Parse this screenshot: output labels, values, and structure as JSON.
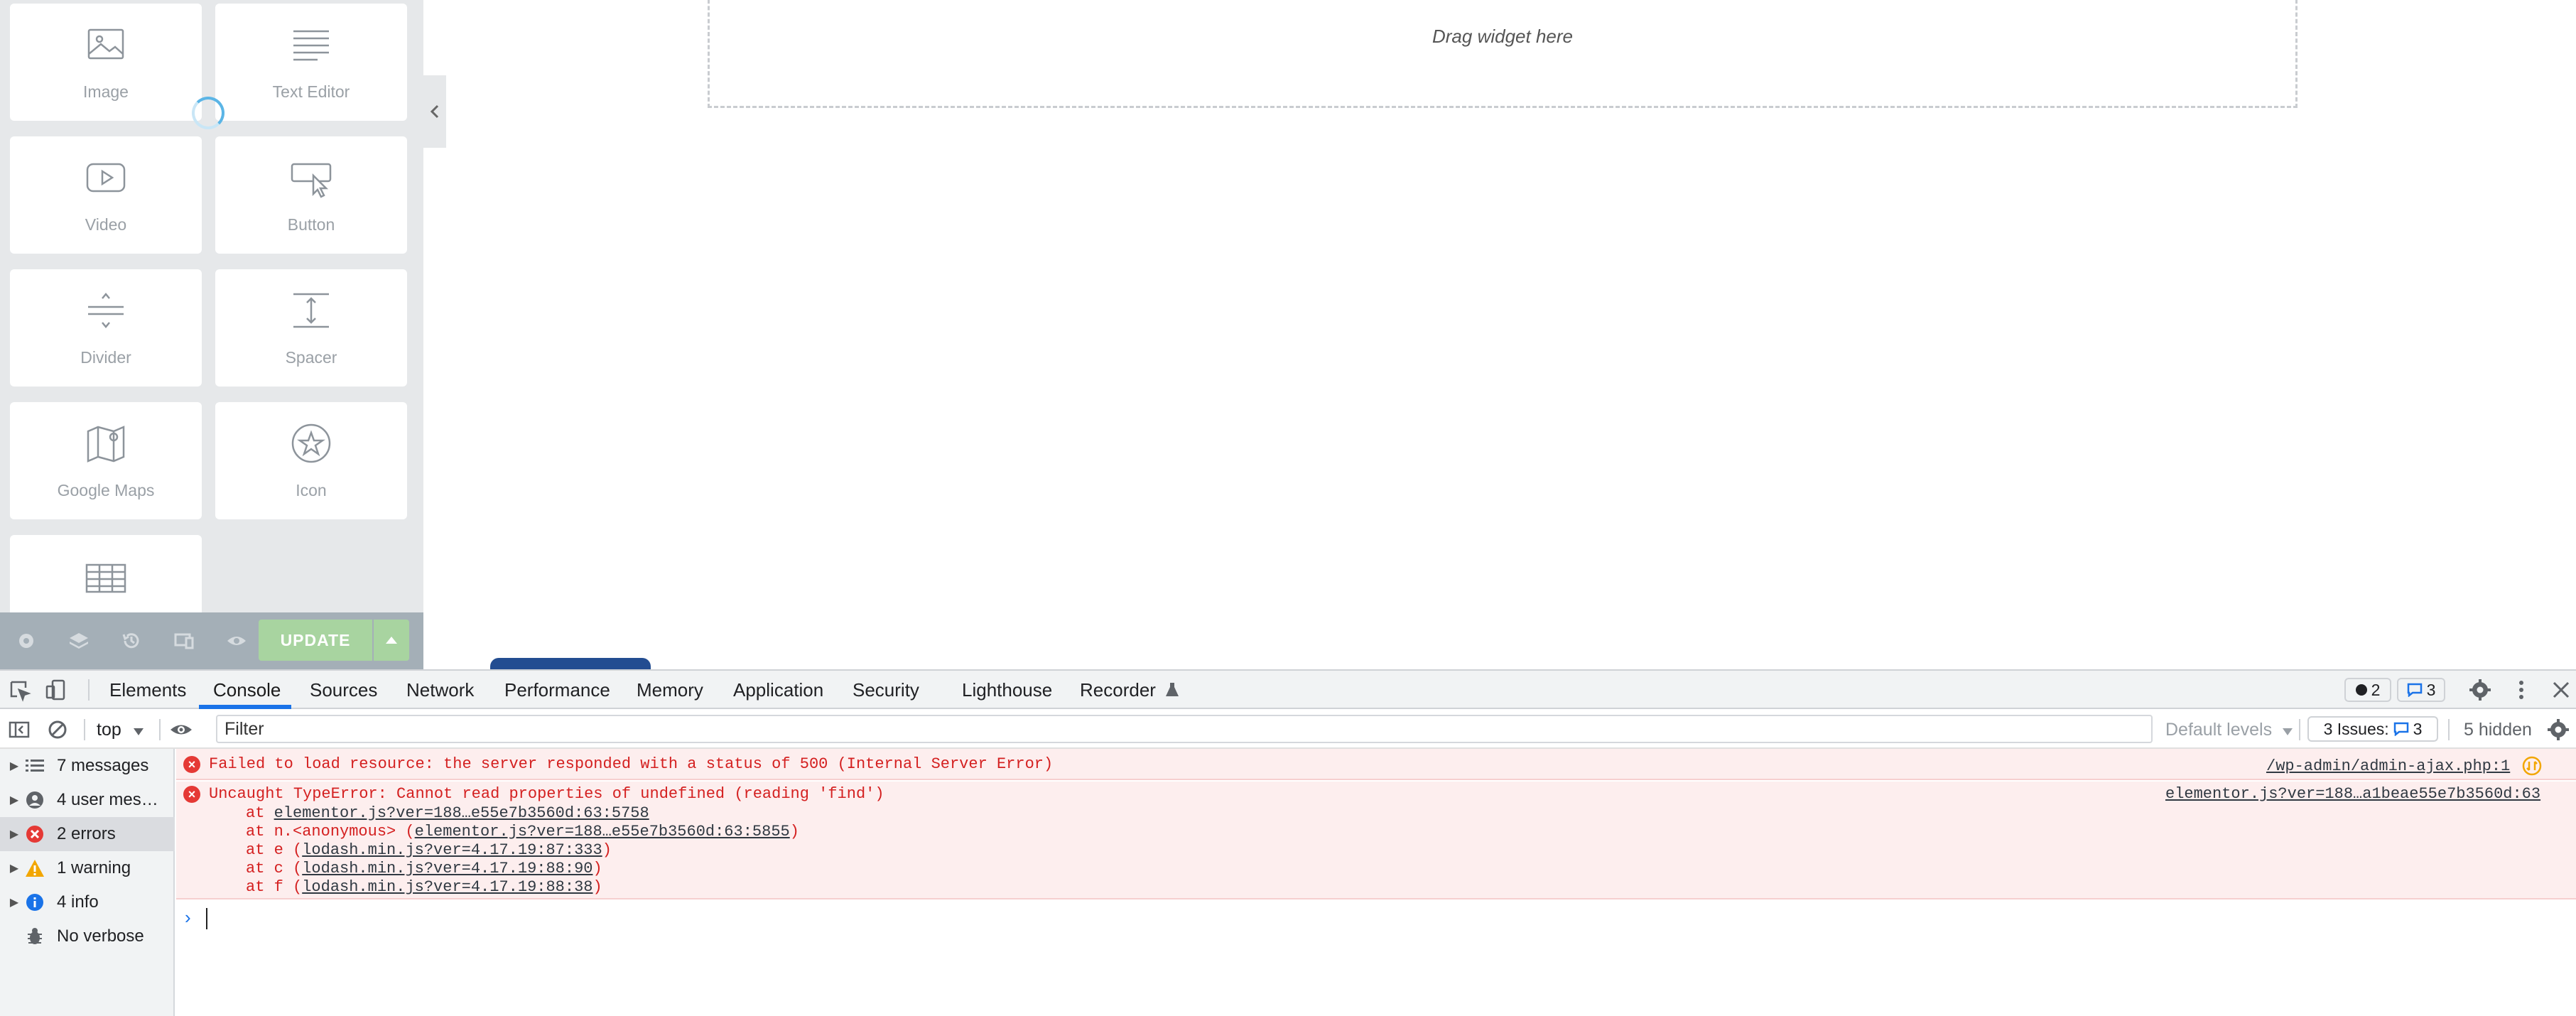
{
  "panel": {
    "widgets": [
      {
        "label": "Image",
        "icon": "image-icon"
      },
      {
        "label": "Text Editor",
        "icon": "text-editor-icon"
      },
      {
        "label": "Video",
        "icon": "video-icon"
      },
      {
        "label": "Button",
        "icon": "button-icon"
      },
      {
        "label": "Divider",
        "icon": "divider-icon"
      },
      {
        "label": "Spacer",
        "icon": "spacer-icon"
      },
      {
        "label": "Google Maps",
        "icon": "google-maps-icon"
      },
      {
        "label": "Icon",
        "icon": "star-icon"
      },
      {
        "label": "",
        "icon": "table-icon"
      }
    ],
    "footer": {
      "update_label": "UPDATE"
    }
  },
  "canvas": {
    "drop_text": "Drag widget here",
    "circle_colors": [
      "#8b1538",
      "#6d7882",
      "#e2335a"
    ]
  },
  "devtools": {
    "tabs": [
      "Elements",
      "Console",
      "Sources",
      "Network",
      "Performance",
      "Memory",
      "Application",
      "Security",
      "Lighthouse",
      "Recorder"
    ],
    "active_tab": "Console",
    "error_badge": "2",
    "message_badge": "3",
    "context": "top",
    "filter_placeholder": "Filter",
    "default_levels": "Default levels",
    "issues_label": "3 Issues:",
    "issues_count": "3",
    "hidden": "5 hidden",
    "sidebar": [
      {
        "label": "7 messages",
        "icon": "list-icon"
      },
      {
        "label": "4 user mes…",
        "icon": "user-icon"
      },
      {
        "label": "2 errors",
        "icon": "error-icon"
      },
      {
        "label": "1 warning",
        "icon": "warning-icon"
      },
      {
        "label": "4 info",
        "icon": "info-icon"
      },
      {
        "label": "No verbose",
        "icon": "bug-icon"
      }
    ],
    "messages": {
      "error1": {
        "text": "Failed to load resource: the server responded with a status of 500 (Internal Server Error)",
        "source": "/wp-admin/admin-ajax.php:1"
      },
      "error2": {
        "text": "Uncaught TypeError: Cannot read properties of undefined (reading 'find')",
        "source": "elementor.js?ver=188…a1beae55e7b3560d:63",
        "stack": [
          {
            "prefix": "at ",
            "link": "elementor.js?ver=188…e55e7b3560d:63:5758",
            "suffix": ""
          },
          {
            "prefix": "at n.<anonymous> (",
            "link": "elementor.js?ver=188…e55e7b3560d:63:5855",
            "suffix": ")"
          },
          {
            "prefix": "at e (",
            "link": "lodash.min.js?ver=4.17.19:87:333",
            "suffix": ")"
          },
          {
            "prefix": "at c (",
            "link": "lodash.min.js?ver=4.17.19:88:90",
            "suffix": ")"
          },
          {
            "prefix": "at f (",
            "link": "lodash.min.js?ver=4.17.19:88:38",
            "suffix": ")"
          }
        ]
      }
    },
    "prompt_symbol": "›"
  }
}
